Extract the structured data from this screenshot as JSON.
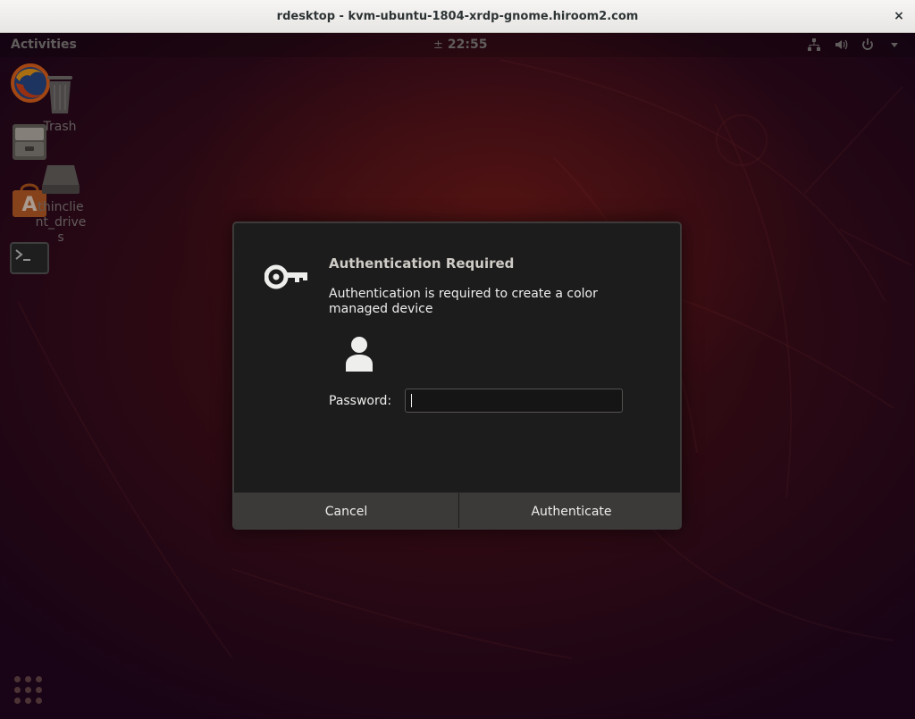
{
  "window": {
    "title": "rdesktop - kvm-ubuntu-1804-xrdp-gnome.hiroom2.com",
    "close_label": "×"
  },
  "topbar": {
    "activities": "Activities",
    "clock": "22:55",
    "accessibility_glyph": "±",
    "tray_icons": [
      "network-icon",
      "volume-icon",
      "power-icon",
      "dropdown-arrow-icon"
    ]
  },
  "dock": {
    "items": [
      "firefox",
      "files",
      "software-center",
      "terminal"
    ],
    "show_apps": "show-applications"
  },
  "desktop_icons": [
    {
      "name": "Trash"
    },
    {
      "name": "thinclient_drives"
    }
  ],
  "dialog": {
    "title": "Authentication Required",
    "description": "Authentication is required to create a color managed device",
    "password_label": "Password:",
    "password_value": "",
    "cancel": "Cancel",
    "authenticate": "Authenticate"
  },
  "colors": {
    "dialog_bg": "#1d1c1c",
    "button_bg": "#3b3a38",
    "wallpaper_red": "#5c1616",
    "wallpaper_purple": "#230720"
  }
}
